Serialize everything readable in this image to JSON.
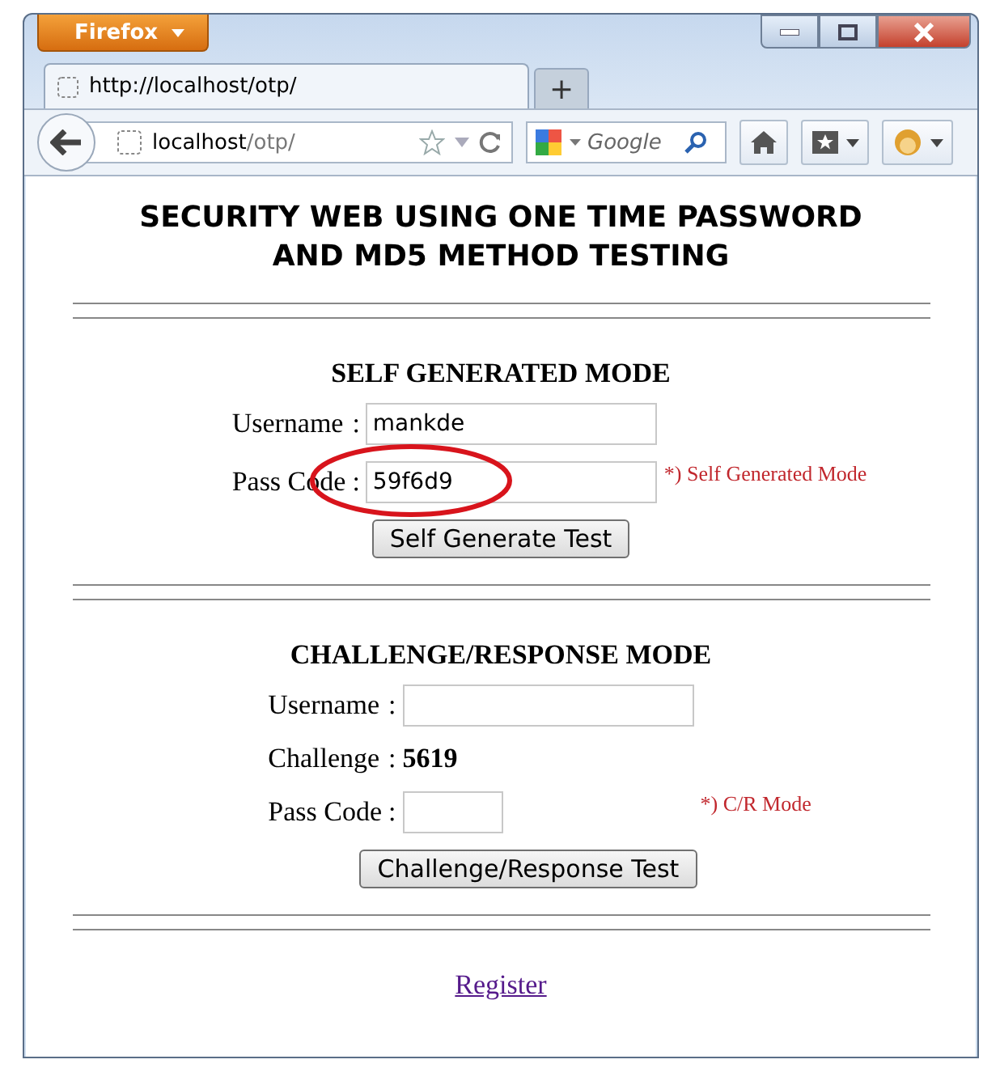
{
  "browser": {
    "menu_label": "Firefox"
  },
  "tab": {
    "title": "http://localhost/otp/",
    "selected": true
  },
  "new_tab": "+",
  "address": {
    "host": "localhost",
    "path": "/otp/"
  },
  "search": {
    "placeholder": "Google"
  },
  "page": {
    "heading": [
      "SECURITY WEB USING ONE TIME PASSWORD",
      "AND MD5 METHOD TESTING"
    ],
    "sections": [
      {
        "title": "SELF GENERATED MODE",
        "rows": [
          {
            "kind": "field",
            "label": "Username",
            "separator": ":",
            "value": "mankde",
            "note": "",
            "circled": false
          },
          {
            "kind": "field",
            "label": "Pass Code",
            "separator": ":",
            "value": "59f6d9",
            "note": "*) Self Generated Mode",
            "circled": true
          }
        ],
        "button": "Self Generate Test"
      },
      {
        "title": "CHALLENGE/RESPONSE MODE",
        "rows": [
          {
            "kind": "field",
            "label": "Username",
            "separator": ":",
            "value": "",
            "note": "",
            "circled": false
          },
          {
            "kind": "value",
            "label": "Challenge",
            "separator": ":",
            "value": "5619"
          },
          {
            "kind": "short_field",
            "label": "Pass Code",
            "separator": ":",
            "value": "",
            "note": "*) C/R Mode",
            "circled": false
          }
        ],
        "button": "Challenge/Response Test"
      }
    ],
    "link": "Register"
  }
}
